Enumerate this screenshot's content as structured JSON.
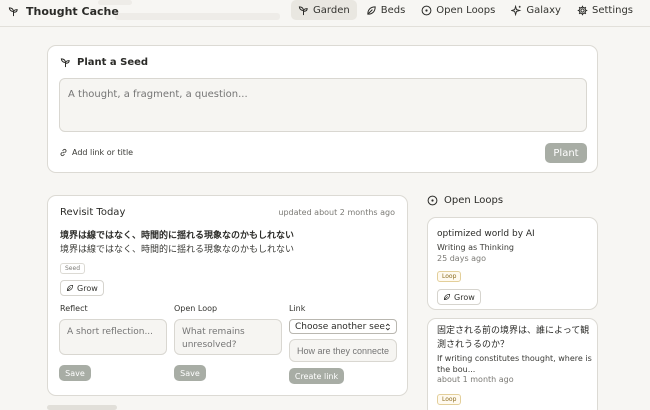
{
  "header": {
    "app_title": "Thought Cache",
    "nav": [
      {
        "label": "Garden",
        "icon": "sprout-icon",
        "active": true
      },
      {
        "label": "Beds",
        "icon": "leaf-icon",
        "active": false
      },
      {
        "label": "Open Loops",
        "icon": "open-loop-icon",
        "active": false
      },
      {
        "label": "Galaxy",
        "icon": "sparkles-icon",
        "active": false
      },
      {
        "label": "Settings",
        "icon": "gear-icon",
        "active": false
      }
    ]
  },
  "plant": {
    "heading": "Plant a Seed",
    "placeholder": "A thought, a fragment, a question...",
    "add_link_label": "Add link or title",
    "submit_label": "Plant"
  },
  "revisit": {
    "heading": "Revisit Today",
    "updated": "updated about 2 months ago",
    "title": "境界は線ではなく、時間的に揺れる現象なのかもしれない",
    "body": "境界は線ではなく、時間的に揺れる現象なのかもしれない",
    "tag": "Seed",
    "grow_label": "Grow",
    "reflect": {
      "label": "Reflect",
      "placeholder": "A short reflection...",
      "save_label": "Save"
    },
    "open_loop": {
      "label": "Open Loop",
      "placeholder": "What remains unresolved?",
      "save_label": "Save"
    },
    "link": {
      "label": "Link",
      "selected": "Choose another seed",
      "placeholder": "How are they connected?",
      "button_label": "Create link"
    }
  },
  "open_loops": {
    "heading": "Open Loops",
    "items": [
      {
        "title": "optimized world by AI",
        "subtitle": "Writing as Thinking",
        "date": "25 days ago",
        "tag": "Loop",
        "grow_label": "Grow"
      },
      {
        "title": "固定される前の境界は、誰によって観測されうるのか？",
        "subtitle": "If writing constitutes thought, where is the bou...",
        "date": "about 1 month ago",
        "tag": "Loop"
      }
    ]
  },
  "colors": {
    "background": "#f7f6f3",
    "muted_button": "#a8ada5",
    "loop_tag": "#8a6a1c"
  }
}
